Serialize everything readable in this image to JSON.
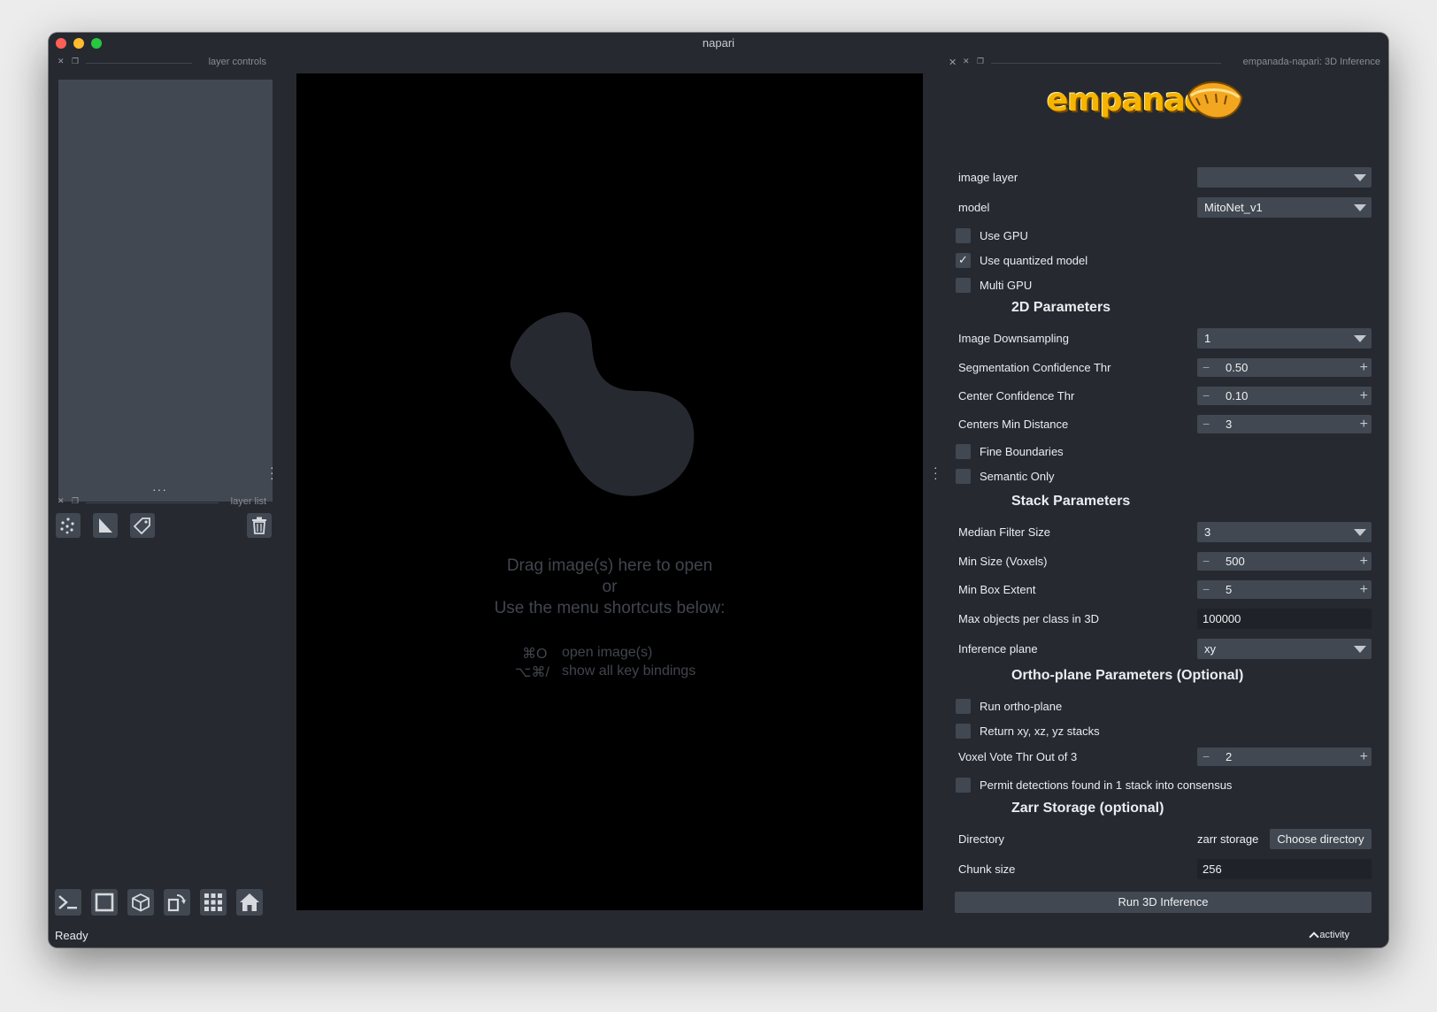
{
  "window": {
    "title": "napari"
  },
  "left_dock": {
    "controls_label": "layer controls",
    "list_label": "layer list",
    "tools": [
      {
        "icon": "new-points-layer-icon"
      },
      {
        "icon": "new-shapes-layer-icon"
      },
      {
        "icon": "new-labels-layer-icon"
      },
      {
        "icon": "delete-layer-icon"
      }
    ],
    "bottom_buttons": [
      {
        "icon": "console-icon"
      },
      {
        "icon": "toggle-ndisplay-icon"
      },
      {
        "icon": "roll-dims-icon"
      },
      {
        "icon": "transpose-dims-icon"
      },
      {
        "icon": "grid-view-icon"
      },
      {
        "icon": "home-icon"
      }
    ]
  },
  "canvas": {
    "drop_line1": "Drag image(s) here to open",
    "drop_line2": "or",
    "drop_line3": "Use the menu shortcuts below:",
    "shortcuts": [
      {
        "keys": "⌘O",
        "label": "open image(s)"
      },
      {
        "keys": "⌥⌘/",
        "label": "show all key bindings"
      }
    ]
  },
  "plugin": {
    "dock_title": "empanada-napari: 3D Inference",
    "logo_text": "empanada",
    "image_layer": {
      "label": "image layer",
      "value": ""
    },
    "model": {
      "label": "model",
      "value": "MitoNet_v1"
    },
    "use_gpu": {
      "label": "Use GPU",
      "checked": false
    },
    "use_quantized": {
      "label": "Use quantized model",
      "checked": true,
      "mark": "✓"
    },
    "multi_gpu": {
      "label": "Multi GPU",
      "checked": false
    },
    "section_2d": "2D Parameters",
    "image_downsampling": {
      "label": "Image Downsampling",
      "value": "1"
    },
    "seg_conf": {
      "label": "Segmentation Confidence Thr",
      "value": "0.50"
    },
    "center_conf": {
      "label": "Center Confidence Thr",
      "value": "0.10"
    },
    "centers_min_dist": {
      "label": "Centers Min Distance",
      "value": "3"
    },
    "fine_boundaries": {
      "label": "Fine Boundaries",
      "checked": false
    },
    "semantic_only": {
      "label": "Semantic Only",
      "checked": false
    },
    "section_stack": "Stack Parameters",
    "median_filter": {
      "label": "Median Filter Size",
      "value": "3"
    },
    "min_size": {
      "label": "Min Size (Voxels)",
      "value": "500"
    },
    "min_box": {
      "label": "Min Box Extent",
      "value": "5"
    },
    "max_objects": {
      "label": "Max objects per class in 3D",
      "value": "100000"
    },
    "inference_plane": {
      "label": "Inference plane",
      "value": "xy"
    },
    "section_ortho": "Ortho-plane Parameters (Optional)",
    "run_ortho": {
      "label": "Run ortho-plane",
      "checked": false
    },
    "return_stacks": {
      "label": "Return xy, xz, yz stacks",
      "checked": false
    },
    "voxel_vote": {
      "label": "Voxel Vote Thr Out of 3",
      "value": "2"
    },
    "permit_detections": {
      "label": "Permit detections found in 1 stack into consensus",
      "checked": false
    },
    "section_zarr": "Zarr Storage (optional)",
    "directory": {
      "label": "Directory",
      "value": "zarr storage",
      "button": "Choose directory"
    },
    "chunk_size": {
      "label": "Chunk size",
      "value": "256"
    },
    "run_button": "Run 3D Inference",
    "symbols": {
      "minus": "−",
      "plus": "+"
    }
  },
  "status": {
    "text": "Ready",
    "activity": "activity"
  },
  "colors": {
    "background": "#262930",
    "widget": "#414851",
    "canvas": "#000000",
    "accent": "#f5b400"
  }
}
